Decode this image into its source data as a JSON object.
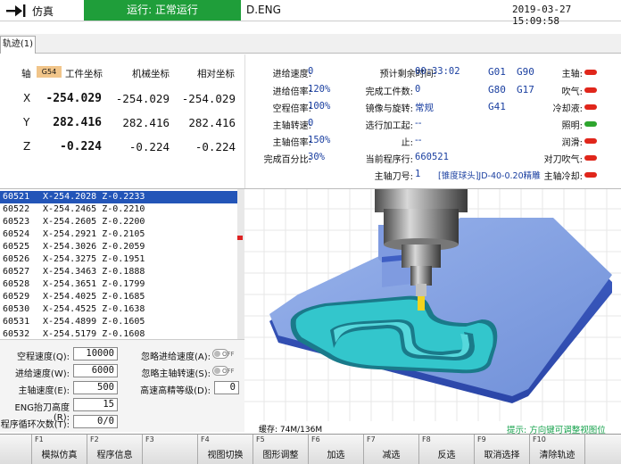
{
  "topbar": {
    "mode": "仿真",
    "status": "运行: 正常运行",
    "file": "D.ENG",
    "datetime": "2019-03-27 15:09:58",
    "status_color": "#1f9e3a"
  },
  "tab": {
    "label": "轨迹(1)"
  },
  "coords": {
    "axis_header": "轴",
    "work_system": "G54",
    "work_header": "工件坐标",
    "machine_header": "机械坐标",
    "relative_header": "相对坐标",
    "rows": [
      {
        "axis": "X",
        "work": "-254.029",
        "machine": "-254.029",
        "relative": "-254.029"
      },
      {
        "axis": "Y",
        "work": "282.416",
        "machine": "282.416",
        "relative": "282.416"
      },
      {
        "axis": "Z",
        "work": "-0.224",
        "machine": "-0.224",
        "relative": "-0.224"
      }
    ]
  },
  "status": {
    "feed_speed_label": "进给速度:",
    "feed_speed": "0",
    "feed_rate_label": "进给倍率:",
    "feed_rate": "120%",
    "rapid_rate_label": "空程倍率:",
    "rapid_rate": "100%",
    "spindle_speed_label": "主轴转速:",
    "spindle_speed": "0",
    "spindle_rate_label": "主轴倍率:",
    "spindle_rate": "150%",
    "percent_label": "完成百分比:",
    "percent": "30%",
    "remaining_label": "预计剩余时间:",
    "remaining": "00:33:02",
    "finished_label": "完成工件数:",
    "finished": "0",
    "mirror_label": "镜像与旋转:",
    "mirror": "常规",
    "select_start_label": "选行加工起:",
    "select_start": "--",
    "select_end_label": "止:",
    "select_end": "--",
    "line_label": "当前程序行:",
    "line": "660521",
    "tool_label": "主轴刀号:",
    "tool_no": "1",
    "tool_name": "[锥度球头]JD-40-0.20精雕",
    "gcodes": [
      "G01",
      "G90",
      "G80",
      "G17",
      "G41"
    ],
    "indicators": [
      {
        "label": "主轴:",
        "color": "#e0261b"
      },
      {
        "label": "吹气:",
        "color": "#e0261b"
      },
      {
        "label": "冷却液:",
        "color": "#e0261b"
      },
      {
        "label": "照明:",
        "color": "#2ea52e"
      },
      {
        "label": "润滑:",
        "color": "#e0261b"
      },
      {
        "label": "对刀吹气:",
        "color": "#e0261b"
      },
      {
        "label": "主轴冷却:",
        "color": "#e0261b"
      }
    ]
  },
  "code_lines": [
    {
      "n": "60521",
      "t": "X-254.2028 Z-0.2233"
    },
    {
      "n": "60522",
      "t": "X-254.2465 Z-0.2210"
    },
    {
      "n": "60523",
      "t": "X-254.2605 Z-0.2200"
    },
    {
      "n": "60524",
      "t": "X-254.2921 Z-0.2105"
    },
    {
      "n": "60525",
      "t": "X-254.3026 Z-0.2059"
    },
    {
      "n": "60526",
      "t": "X-254.3275 Z-0.1951"
    },
    {
      "n": "60527",
      "t": "X-254.3463 Z-0.1888"
    },
    {
      "n": "60528",
      "t": "X-254.3651 Z-0.1799"
    },
    {
      "n": "60529",
      "t": "X-254.4025 Z-0.1685"
    },
    {
      "n": "60530",
      "t": "X-254.4525 Z-0.1638"
    },
    {
      "n": "60531",
      "t": "X-254.4899 Z-0.1605"
    },
    {
      "n": "60532",
      "t": "X-254.5179 Z-0.1608"
    }
  ],
  "params": {
    "rapid_speed_label": "空程速度(Q):",
    "rapid_speed": "10000",
    "feed_speed_label": "进给速度(W):",
    "feed_speed": "6000",
    "spindle_speed_label": "主轴速度(E):",
    "spindle_speed": "500",
    "lift_label": "ENG抬刀高度(R):",
    "lift": "15",
    "loop_label": "程序循环次数(T):",
    "loop": "0/0",
    "ignore_feed_label": "忽略进给速度(A):",
    "ignore_spindle_label": "忽略主轴转速(S):",
    "toggle_text": "OFF",
    "hs_level_label": "高速高精等级(D):",
    "hs_level": "0"
  },
  "view": {
    "cache": "缓存: 74M/136M",
    "hint": "提示: 方向键可调整视图位置。"
  },
  "fkeys": [
    {
      "key": "F1",
      "label": "模拟仿真"
    },
    {
      "key": "F2",
      "label": "程序信息"
    },
    {
      "key": "F3",
      "label": ""
    },
    {
      "key": "F4",
      "label": "视图切换"
    },
    {
      "key": "F5",
      "label": "图形调整"
    },
    {
      "key": "F6",
      "label": "加选"
    },
    {
      "key": "F7",
      "label": "减选"
    },
    {
      "key": "F8",
      "label": "反选"
    },
    {
      "key": "F9",
      "label": "取消选择"
    },
    {
      "key": "F10",
      "label": "清除轨迹"
    }
  ]
}
